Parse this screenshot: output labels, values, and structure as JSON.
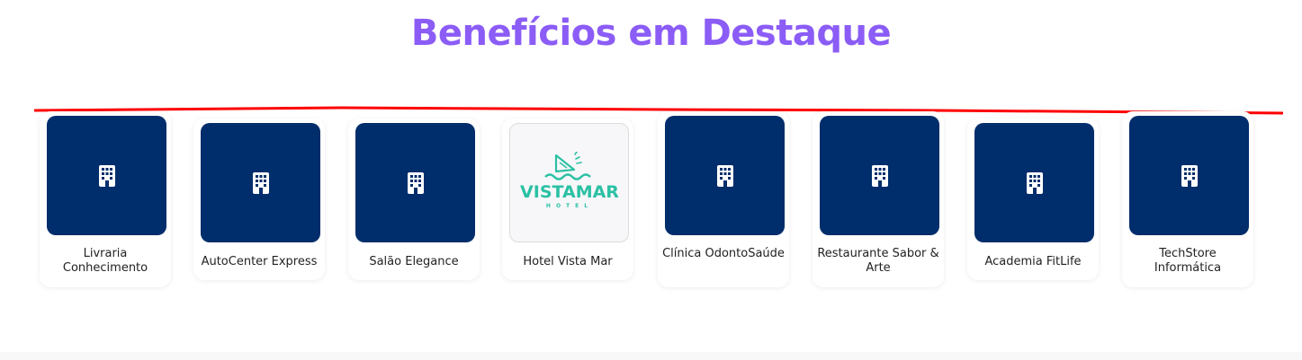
{
  "section": {
    "title": "Benefícios em Destaque",
    "title_color": "#8b5cf6"
  },
  "colors": {
    "card_thumb_bg": "#002d6b",
    "divider": "#ff0000",
    "logo_accent": "#2bc0a4"
  },
  "partners": [
    {
      "name": "Livraria Conhecimento",
      "icon": "building-icon"
    },
    {
      "name": "AutoCenter Express",
      "icon": "building-icon"
    },
    {
      "name": "Salão Elegance",
      "icon": "building-icon"
    },
    {
      "name": "Hotel Vista Mar",
      "icon": "vistamar-logo",
      "logo_text": "VISTAMAR",
      "logo_subtext": "HOTEL"
    },
    {
      "name": "Clínica OdontoSaúde",
      "icon": "building-icon"
    },
    {
      "name": "Restaurante Sabor & Arte",
      "icon": "building-icon"
    },
    {
      "name": "Academia FitLife",
      "icon": "building-icon"
    },
    {
      "name": "TechStore Informática",
      "icon": "building-icon"
    }
  ]
}
